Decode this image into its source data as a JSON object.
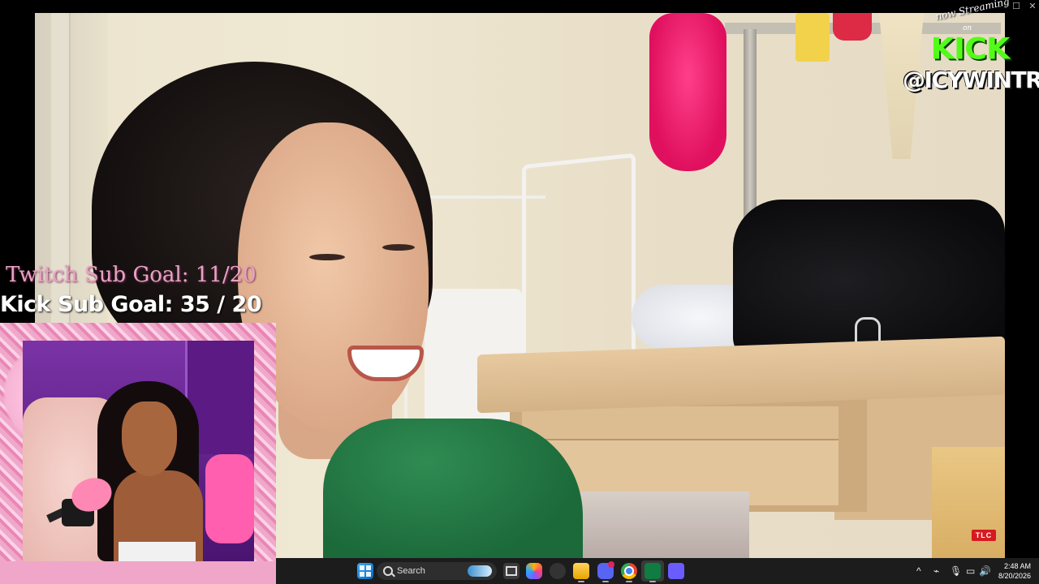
{
  "window": {
    "minimize_glyph": "–",
    "maximize_glyph": "☐",
    "close_glyph": "✕"
  },
  "video": {
    "network_bug": "TLC"
  },
  "kick_overlay": {
    "now_streaming": "now Streaming",
    "on": "on",
    "logo": "KICK",
    "handle": "@ICYWINTRR"
  },
  "goals": {
    "twitch": "Twitch Sub Goal: 11/20",
    "kick": "Kick Sub Goal: 35 / 20"
  },
  "taskbar": {
    "search_placeholder": "Search",
    "icons": [
      "windows-start-icon",
      "search-icon",
      "task-view-icon",
      "copilot-icon",
      "cycle-app-icon",
      "file-explorer-icon",
      "discord-icon",
      "chrome-icon",
      "excel-icon",
      "apps-grid-icon"
    ],
    "discord_badge": "9+",
    "tray": {
      "chevron": "^",
      "network": "⌁",
      "mic": "🎙",
      "display": "▭",
      "volume": "🔊"
    },
    "clock": {
      "time": "2:48 AM",
      "date": "8/20/2026"
    }
  },
  "colors": {
    "kick_green": "#53fc18",
    "twitch_pink": "#e7a3c4",
    "taskbar": "#1c1c1c",
    "tlc_red": "#d71920"
  }
}
